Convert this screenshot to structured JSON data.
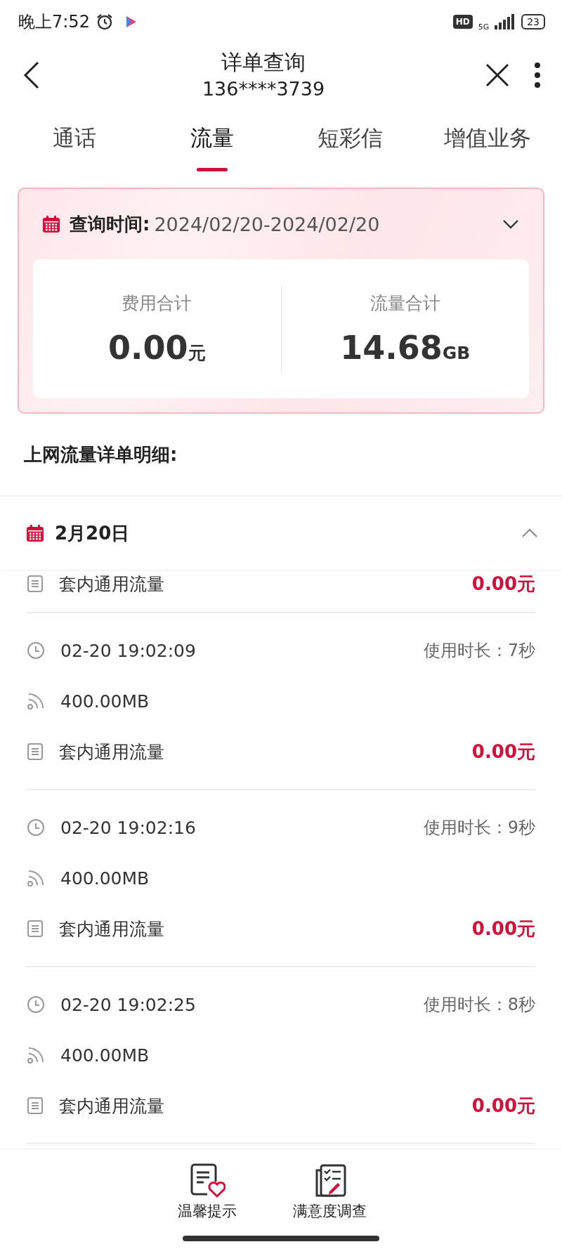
{
  "status_bar": {
    "time": "晚上7:52",
    "hd": "HD",
    "network": "5G",
    "battery": "23"
  },
  "header": {
    "title": "详单查询",
    "subtitle": "136****3739"
  },
  "tabs": [
    {
      "label": "通话",
      "selected": false
    },
    {
      "label": "流量",
      "selected": true
    },
    {
      "label": "短彩信",
      "selected": false
    },
    {
      "label": "增值业务",
      "selected": false
    }
  ],
  "query": {
    "label": "查询时间:",
    "range": "2024/02/20-2024/02/20"
  },
  "summary": [
    {
      "label": "费用合计",
      "value": "0.00",
      "unit": "元"
    },
    {
      "label": "流量合计",
      "value": "14.68",
      "unit": "GB"
    }
  ],
  "section_title": "上网流量详单明细:",
  "day_group": {
    "date": "2月20日",
    "expanded": true,
    "partial_record": {
      "plan": "套内通用流量",
      "fee": "0.00元"
    },
    "records": [
      {
        "time": "02-20 19:02:09",
        "duration": "使用时长：7秒",
        "volume": "400.00MB",
        "plan": "套内通用流量",
        "fee": "0.00元"
      },
      {
        "time": "02-20 19:02:16",
        "duration": "使用时长：9秒",
        "volume": "400.00MB",
        "plan": "套内通用流量",
        "fee": "0.00元"
      },
      {
        "time": "02-20 19:02:25",
        "duration": "使用时长：8秒",
        "volume": "400.00MB",
        "plan": "套内通用流量",
        "fee": "0.00元"
      }
    ]
  },
  "bottom_nav": [
    {
      "label": "温馨提示",
      "kind": "tips"
    },
    {
      "label": "满意度调查",
      "kind": "survey"
    }
  ]
}
